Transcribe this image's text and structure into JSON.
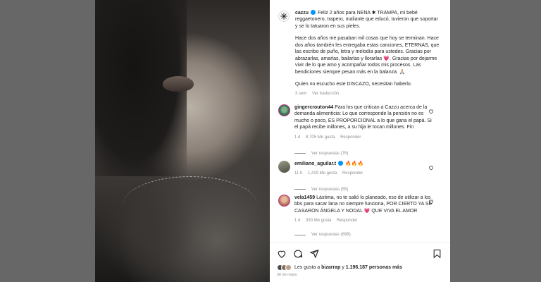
{
  "post": {
    "author": "cazzu",
    "caption_p1": "Feliz 2 años para NENA ✱ TRAMPA, mi bebé reggaetonero, trapero, maliante que educó, tuvieron que soportar y se lo tatuaron en sus pieles.",
    "caption_p2": "Hace dos años me pasaban mil cosas que hoy se terminan. Hace dos años también les entregaba estas canciones, ETERNAS, que las escribo de puño, letra y melodía para ustedes. Gracias por abrazarlas, amarlas, bailarlas y llorarlas 💗. Gracias por dejarme vivir de lo que amo y acompañar todos mis procesos. Las bendiciones siempre pesan más en la balanza. 🙏🏼",
    "caption_p3": "Quien no escucho este DISCAZO, necesitan haberlo.",
    "time": "3 sem",
    "translate": "Ver traducción"
  },
  "comments": [
    {
      "user": "gingercrouton44",
      "text": "Para los que critican a Cazzu acerca de la demanda alimenticia: Lo que corresponde la pensión no es mucho o poco, ES PROPORCIONAL a lo que gana el papá. Si el papá recibe millones, a su hija le tocan millones. Fin",
      "time": "1 d",
      "likes": "8,705 Me gusta",
      "reply": "Responder",
      "more_replies": "Ver respuestas (76)",
      "avatar_color": "#2f6e4e"
    },
    {
      "user": "emiliano_aguilar.t",
      "text": "🔥🔥🔥",
      "time": "11 h",
      "likes": "1,419 Me gusta",
      "reply": "Responder",
      "more_replies": "Ver respuestas (55)",
      "avatar_color": "#6b6f58"
    },
    {
      "user": "vela1459",
      "text": "Lástima, no te salió lo planeado, eso de utilizar a los bbs para sacar lana no siempre funciona, POR CIERTO YA SE CASARON ÁNGELA Y NODAL 💗 QUE VIVA EL AMOR",
      "time": "1 d",
      "likes": "330 Me gusta",
      "reply": "Responder",
      "more_replies": "Ver respuestas (698)",
      "avatar_color": "#c98a6a"
    }
  ],
  "footer": {
    "likes_prefix": "Les gusta a",
    "liked_by": "bizarrap",
    "likes_join": "y",
    "likes_count": "1.196.187 personas más",
    "date": "30 de mayo"
  },
  "icons": {
    "heart": "heart-icon",
    "comment": "comment-icon",
    "share": "share-icon",
    "save": "bookmark-icon"
  },
  "colors": {
    "verified": "#0095f6",
    "muted": "#8e8e8e",
    "text": "#262626"
  }
}
